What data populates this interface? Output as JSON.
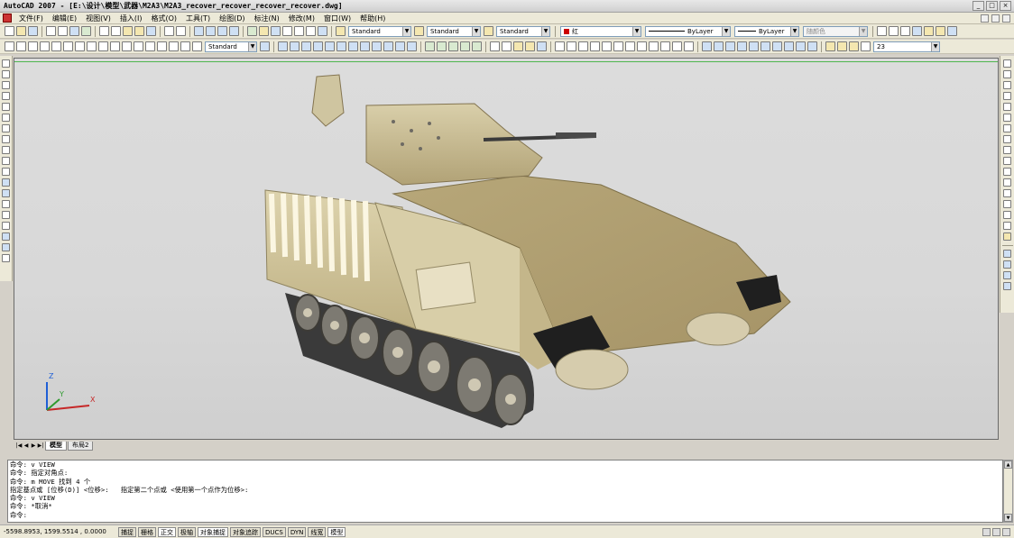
{
  "window": {
    "title": "AutoCAD 2007 - [E:\\设计\\模型\\武器\\M2A3\\M2A3_recover_recover_recover_recover.dwg]",
    "buttons": [
      "_",
      "□",
      "×"
    ]
  },
  "menu": [
    "文件(F)",
    "编辑(E)",
    "视图(V)",
    "插入(I)",
    "格式(O)",
    "工具(T)",
    "绘图(D)",
    "标注(N)",
    "修改(M)",
    "窗口(W)",
    "帮助(H)"
  ],
  "toolbar": {
    "text_style": "Standard",
    "dim_style": "Standard",
    "table_style": "Standard",
    "color": "红",
    "linetype": "ByLayer",
    "lineweight": "ByLayer",
    "plotstyle": "随颜色",
    "dim_style2": "Standard",
    "layer_value": "23"
  },
  "tabs": {
    "model": "模型",
    "layout": "布局2"
  },
  "ucs": {
    "x": "X",
    "y": "Y",
    "z": "Z"
  },
  "command_lines": [
    "命令: v VIEW",
    "命令: 指定对角点:",
    "命令: m MOVE 找到 4 个",
    "指定基点或 [位移(D)] <位移>:   指定第二个点或 <使用第一个点作为位移>:",
    "命令: v VIEW",
    "命令: *取消*",
    "命令:"
  ],
  "status": {
    "coords": "-5598.8953,  1599.5514 , 0.0000",
    "buttons": [
      "捕捉",
      "栅格",
      "正交",
      "极轴",
      "对象捕捉",
      "对象追踪",
      "DUCS",
      "DYN",
      "线宽",
      "模型"
    ]
  },
  "colors": {
    "accent": "#4fb64f",
    "vehicle_tan": "#c8b98c",
    "track_dark": "#2a2a2a"
  }
}
